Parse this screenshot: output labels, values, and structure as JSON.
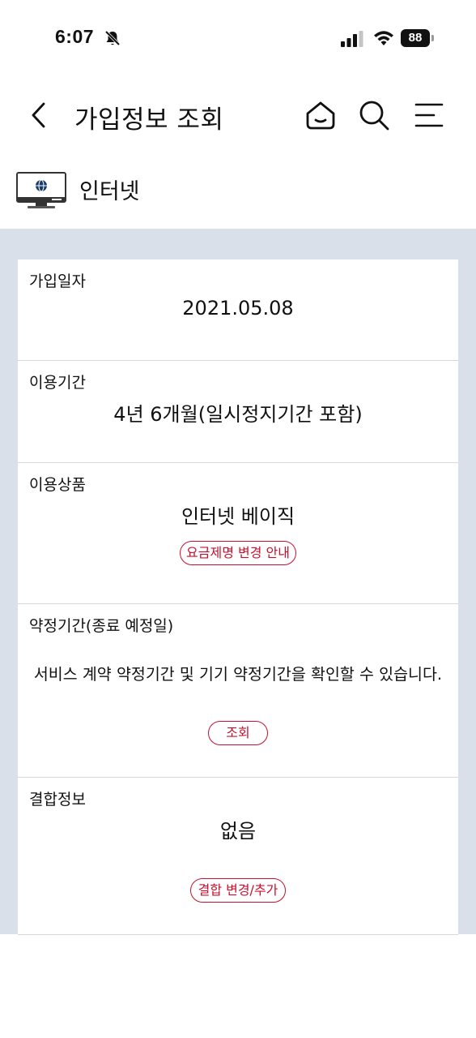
{
  "status_bar": {
    "time": "6:07",
    "battery": "88"
  },
  "header": {
    "title": "가입정보 조회"
  },
  "service": {
    "name": "인터넷"
  },
  "sections": {
    "join_date": {
      "label": "가입일자",
      "value": "2021.05.08"
    },
    "usage_period": {
      "label": "이용기간",
      "value": "4년 6개월(일시정지기간 포함)"
    },
    "product": {
      "label": "이용상품",
      "value": "인터넷 베이직",
      "button": "요금제명 변경 안내"
    },
    "contract": {
      "label": "약정기간(종료 예정일)",
      "description": "서비스 계약 약정기간 및 기기 약정기간을 확인할 수 있습니다.",
      "button": "조회"
    },
    "bundle": {
      "label": "결합정보",
      "value": "없음",
      "button": "결합 변경/추가"
    }
  },
  "colors": {
    "accent": "#c8102e",
    "background": "#d9e0e9"
  }
}
